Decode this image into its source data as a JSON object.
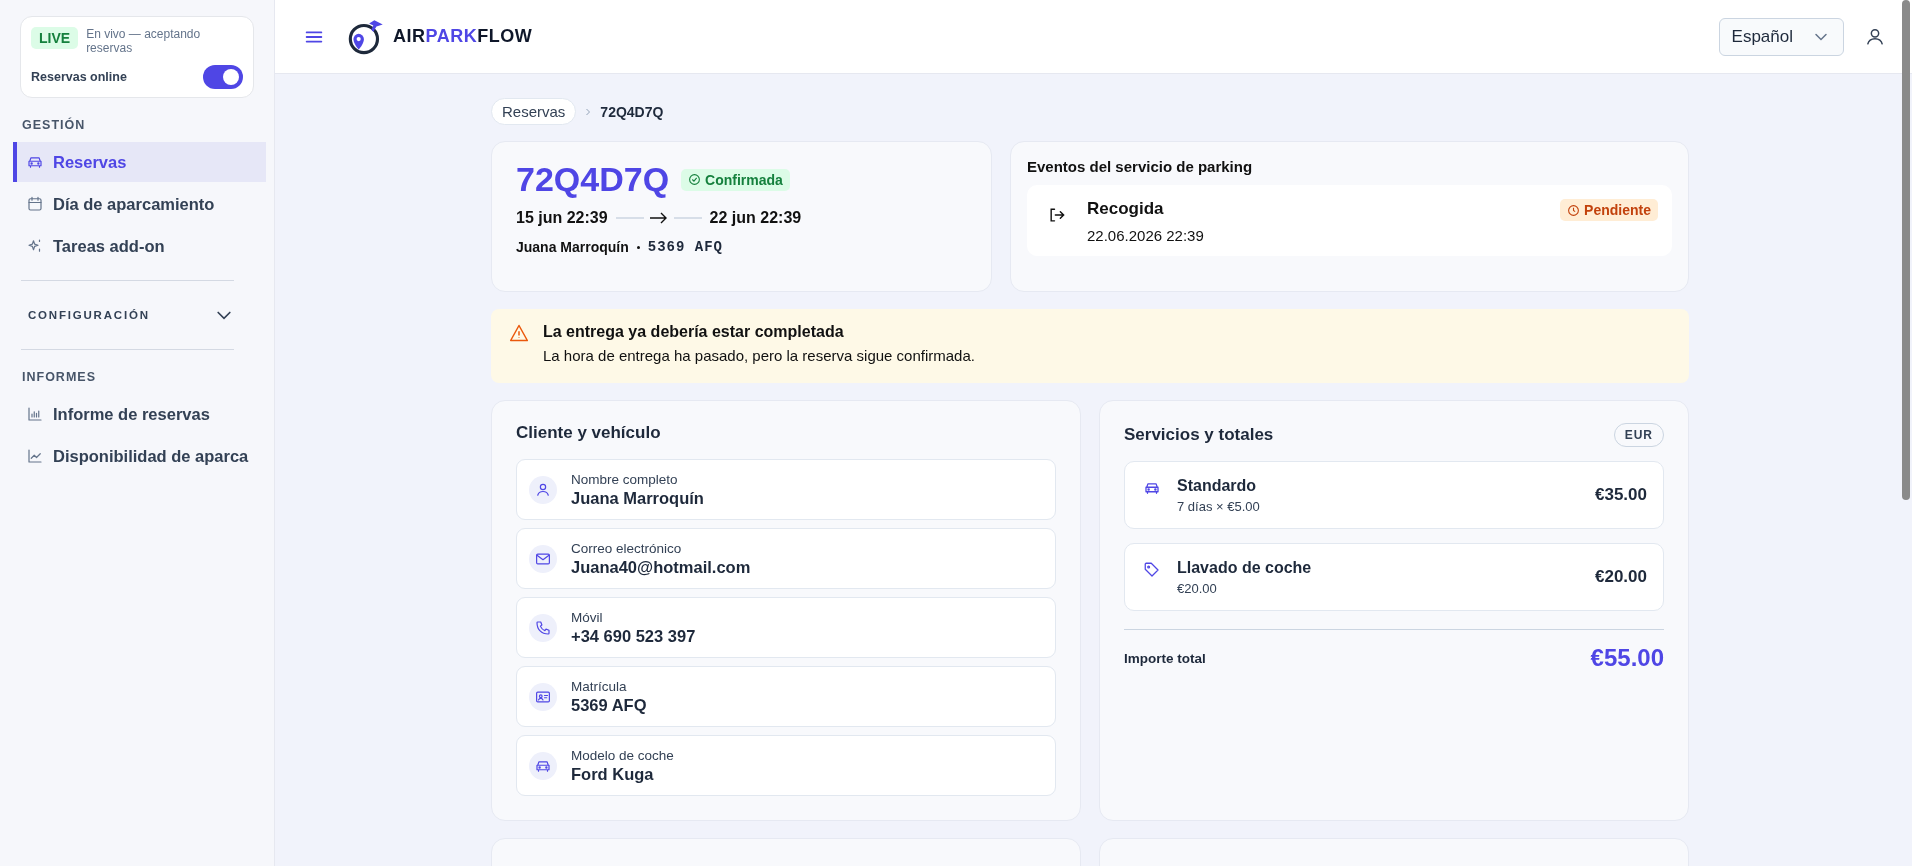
{
  "sidebar": {
    "live": {
      "badge": "LIVE",
      "text": "En vivo — aceptando reservas",
      "toggle_label": "Reservas online",
      "on": true
    },
    "sections": [
      {
        "title": "GESTIÓN",
        "kind": "list",
        "items": [
          {
            "label": "Reservas",
            "selected": true
          },
          {
            "label": "Día de aparcamiento",
            "selected": false
          },
          {
            "label": "Tareas add-on",
            "selected": false
          }
        ]
      },
      {
        "title": "CONFIGURACIÓN",
        "kind": "collapsible",
        "expanded": false
      },
      {
        "title": "INFORMES",
        "kind": "list",
        "items": [
          {
            "label": "Informe de reservas",
            "selected": false
          },
          {
            "label": "Disponibilidad de aparca",
            "selected": false
          }
        ]
      }
    ]
  },
  "header": {
    "logo": {
      "part1": "AIR",
      "part2": "PARK",
      "part3": "FLOW"
    },
    "language": "Español"
  },
  "breadcrumb": {
    "parent": "Reservas",
    "current": "72Q4D7Q"
  },
  "booking": {
    "code": "72Q4D7Q",
    "status": {
      "label": "Confirmada",
      "kind": "success"
    },
    "from": "15 jun 22:39",
    "to": "22 jun 22:39",
    "customer": "Juana Marroquín",
    "plate": "5369 AFQ"
  },
  "events": {
    "title": "Eventos del servicio de parking",
    "items": [
      {
        "name": "Recogida",
        "datetime": "22.06.2026 22:39",
        "status": {
          "label": "Pendiente",
          "kind": "warning"
        }
      }
    ]
  },
  "alert": {
    "title": "La entrega ya debería estar completada",
    "message": "La hora de entrega ha pasado, pero la reserva sigue confirmada."
  },
  "customer_card": {
    "title": "Cliente y vehículo",
    "fields": [
      {
        "label": "Nombre completo",
        "value": "Juana Marroquín"
      },
      {
        "label": "Correo electrónico",
        "value": "Juana40@hotmail.com"
      },
      {
        "label": "Móvil",
        "value": "+34 690 523 397"
      },
      {
        "label": "Matrícula",
        "value": "5369 AFQ"
      },
      {
        "label": "Modelo de coche",
        "value": "Ford Kuga"
      }
    ]
  },
  "services_card": {
    "title": "Servicios y totales",
    "currency": "EUR",
    "items": [
      {
        "name": "Standardo",
        "detail": "7 días × €5.00",
        "price": "€35.00"
      },
      {
        "name": "Llavado de coche",
        "detail": "€20.00",
        "price": "€20.00"
      }
    ],
    "total_label": "Importe total",
    "total": "€55.00"
  }
}
